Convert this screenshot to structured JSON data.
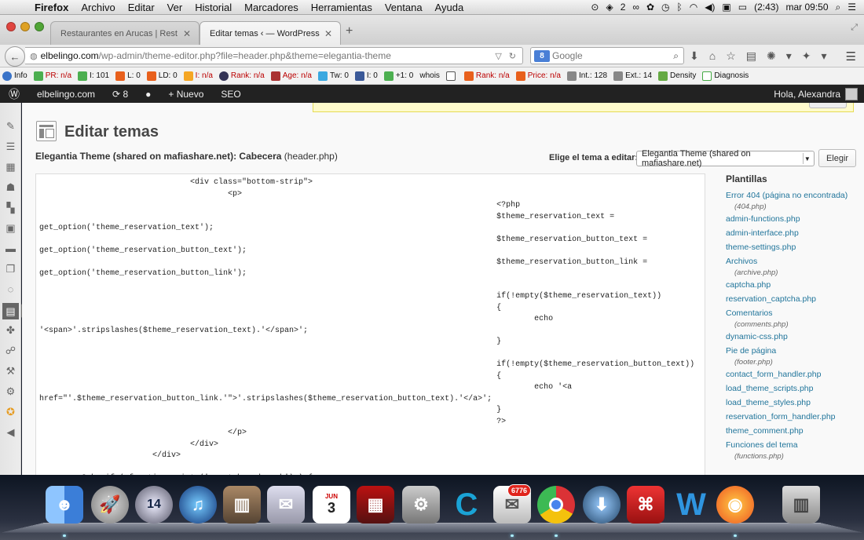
{
  "menubar": {
    "app": "Firefox",
    "items": [
      "Archivo",
      "Editar",
      "Ver",
      "Historial",
      "Marcadores",
      "Herramientas",
      "Ventana",
      "Ayuda"
    ],
    "status_num": "2",
    "battery": "(2:43)",
    "clock": "mar 09:50"
  },
  "tabs": [
    {
      "label": "Restaurantes en Arucas | Rest...",
      "active": false
    },
    {
      "label": "Editar temas ‹ — WordPress",
      "active": true
    }
  ],
  "url": {
    "host": "elbelingo.com",
    "path": "/wp-admin/theme-editor.php?file=header.php&theme=elegantia-theme"
  },
  "search": {
    "placeholder": "Google"
  },
  "seo_bar": {
    "info": "Info",
    "pr": "PR: n/a",
    "i": "I: 101",
    "l": "L: 0",
    "ld": "LD: 0",
    "i2": "I: n/a",
    "rank": "Rank: n/a",
    "age": "Age: n/a",
    "tw": "Tw: 0",
    "fb": "I: 0",
    "plus": "+1: 0",
    "whois": "whois",
    "rank2": "Rank: n/a",
    "price": "Price: n/a",
    "int": "Int.: 128",
    "ext": "Ext.: 14",
    "density": "Density",
    "diagnosis": "Diagnosis"
  },
  "adminbar": {
    "site": "elbelingo.com",
    "updates": "8",
    "new": "Nuevo",
    "seo": "SEO",
    "greeting": "Hola, Alexandra"
  },
  "page": {
    "title": "Editar temas",
    "theme_name": "Elegantia Theme (shared on mafiashare.net): Cabecera",
    "file_name": "(header.php)",
    "select_label": "Elige el tema a editar:",
    "select_value": "Elegantia Theme (shared on mafiashare.net)",
    "select_button": "Elegir"
  },
  "code": [
    "                                <div class=\"bottom-strip\">",
    "                                        <p>",
    "                                                                                                 <?php",
    "                                                                                                 $theme_reservation_text =",
    "get_option('theme_reservation_text');",
    "                                                                                                 $theme_reservation_button_text =",
    "get_option('theme_reservation_button_text');",
    "                                                                                                 $theme_reservation_button_link =",
    "get_option('theme_reservation_button_link');",
    "",
    "                                                                                                 if(!empty($theme_reservation_text))",
    "                                                                                                 {",
    "                                                                                                         echo",
    "'<span>'.stripslashes($theme_reservation_text).'</span>';",
    "                                                                                                 }",
    "",
    "                                                                                                 if(!empty($theme_reservation_button_text))",
    "                                                                                                 {",
    "                                                                                                         echo '<a",
    "href=\"'.$theme_reservation_button_link.'\">'.stripslashes($theme_reservation_button_text).'</a>';",
    "                                                                                                 }",
    "                                                                                                 ?>",
    "                                        </p>",
    "                                </div>",
    "                        </div>",
    "",
    "        <?php if ( function_exists('yoast_breadcrumb') ) {"
  ],
  "templates": {
    "title": "Plantillas",
    "items": [
      {
        "name": "Error 404 (página no encontrada)",
        "file": "(404.php)"
      },
      {
        "name": "admin-functions.php",
        "file": ""
      },
      {
        "name": "admin-interface.php",
        "file": ""
      },
      {
        "name": "theme-settings.php",
        "file": ""
      },
      {
        "name": "Archivos",
        "file": "(archive.php)"
      },
      {
        "name": "captcha.php",
        "file": ""
      },
      {
        "name": "reservation_captcha.php",
        "file": ""
      },
      {
        "name": "Comentarios",
        "file": "(comments.php)"
      },
      {
        "name": "dynamic-css.php",
        "file": ""
      },
      {
        "name": "Pie de página",
        "file": "(footer.php)"
      },
      {
        "name": "contact_form_handler.php",
        "file": ""
      },
      {
        "name": "load_theme_scripts.php",
        "file": ""
      },
      {
        "name": "load_theme_styles.php",
        "file": ""
      },
      {
        "name": "reservation_form_handler.php",
        "file": ""
      },
      {
        "name": "theme_comment.php",
        "file": ""
      },
      {
        "name": "Funciones del tema",
        "file": "(functions.php)"
      }
    ]
  },
  "dock": {
    "calendar_month": "JUN",
    "calendar_day": "3",
    "clock_day": "14",
    "mail_badge": "6776"
  },
  "colors": {
    "link": "#21759b",
    "adminbar": "#222222",
    "notice_bg": "#fffbcc"
  }
}
